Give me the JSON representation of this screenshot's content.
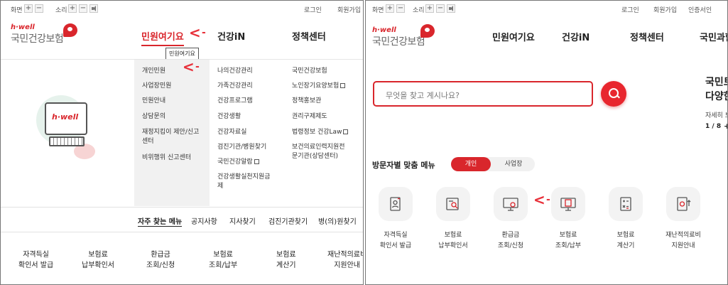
{
  "topbar": {
    "screen_label": "화면",
    "sound_label": "소리",
    "plus": "+",
    "minus": "−",
    "login": "로그인",
    "signup": "회원가입",
    "cert": "인증서인"
  },
  "logo": {
    "en": "h·well",
    "ko": "국민건강보험"
  },
  "nav_left": [
    "민원여기요",
    "건강iN",
    "정책센터"
  ],
  "nav_right": [
    "민원여기요",
    "건강iN",
    "정책센터",
    "국민과함"
  ],
  "tooltip": "민원여기요",
  "annotation_arrow": "<",
  "mega": {
    "col1": [
      "개인민원",
      "사업장민원",
      "민원안내",
      "상담문의",
      "재정지킴이 제안/신고",
      "센터",
      "비위행위 신고센터"
    ],
    "col2": [
      "나의건강관리",
      "가족건강관리",
      "건강프로그램",
      "건강생활",
      "건강자료실",
      "검진기관/병원찾기",
      "국민건강알람",
      "건강생활실천지원금",
      "제"
    ],
    "col3": [
      "국민건강보험",
      "노인장기요양보험",
      "정책홍보관",
      "권리구제제도",
      "법령정보 건강Law",
      "보건의료인력지원전",
      "문기관(상담센터)"
    ]
  },
  "promo_logo": "h·well",
  "quick_bar": [
    "자주 찾는 메뉴",
    "공지사항",
    "지사찾기",
    "검진기관찾기",
    "병(의)원찾기"
  ],
  "bottom_left": [
    [
      "자격득실",
      "확인서 발급"
    ],
    [
      "보험료",
      "납부확인서"
    ],
    [
      "환급금",
      "조회/신청"
    ],
    [
      "보험료",
      "조회/납부"
    ],
    [
      "보험료",
      "계산기"
    ],
    [
      "재난적의료비",
      "지원안내"
    ]
  ],
  "search": {
    "placeholder": "무엇을 찾고 계시나요?"
  },
  "notice": {
    "line1": "국민토",
    "line2": "다양한",
    "sub": "자세히 보",
    "page": "1 / 8"
  },
  "visitor": {
    "title": "방문자별 맞춤 메뉴",
    "tab_on": "개인",
    "tab_off": "사업장"
  },
  "right_menu": [
    [
      "자격득실",
      "확인서 발급"
    ],
    [
      "보험료",
      "납부확인서"
    ],
    [
      "환급금",
      "조회/신청"
    ],
    [
      "보험료",
      "조회/납부"
    ],
    [
      "보험료",
      "계산기"
    ],
    [
      "재난적의료비",
      "지원안내"
    ]
  ],
  "icons": [
    "person-card-icon",
    "receipt-search-icon",
    "monitor-won-icon",
    "monitor-doc-icon",
    "calculator-icon",
    "doc-up-icon"
  ],
  "colors": {
    "brand": "#d9262c",
    "arrow": "#e8303a"
  }
}
